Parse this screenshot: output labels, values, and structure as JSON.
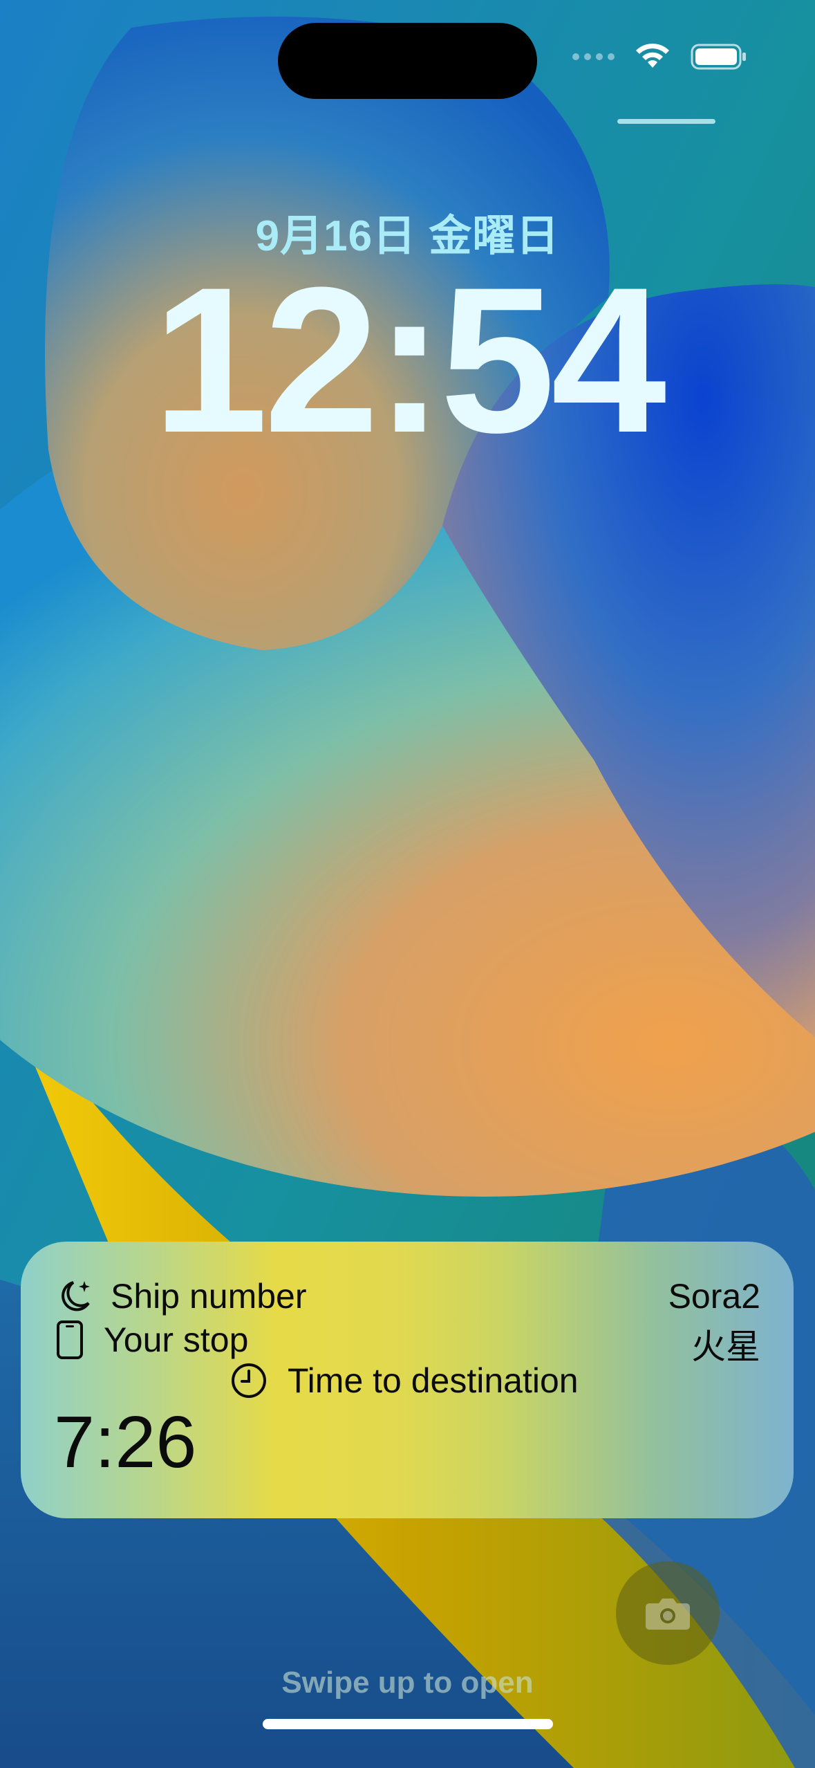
{
  "lock_screen": {
    "date": "9月16日 金曜日",
    "time": "12:54",
    "swipe_hint": "Swipe up to open"
  },
  "status_bar": {
    "icons": [
      "signal-dots-icon",
      "wifi-icon",
      "battery-icon"
    ],
    "battery_level": 1.0
  },
  "live_activity": {
    "ship_label": "Ship number",
    "ship_value": "Sora2",
    "stop_label": "Your stop",
    "stop_value": "火星",
    "destination_label": "Time to destination",
    "remaining_time": "7:26",
    "icons": [
      "moon-stars-icon",
      "phone-icon",
      "clock-icon"
    ]
  },
  "colors": {
    "widget_yellow": "#e6da48",
    "clock_text": "#e6fbff",
    "date_text": "#a9ecf7"
  }
}
